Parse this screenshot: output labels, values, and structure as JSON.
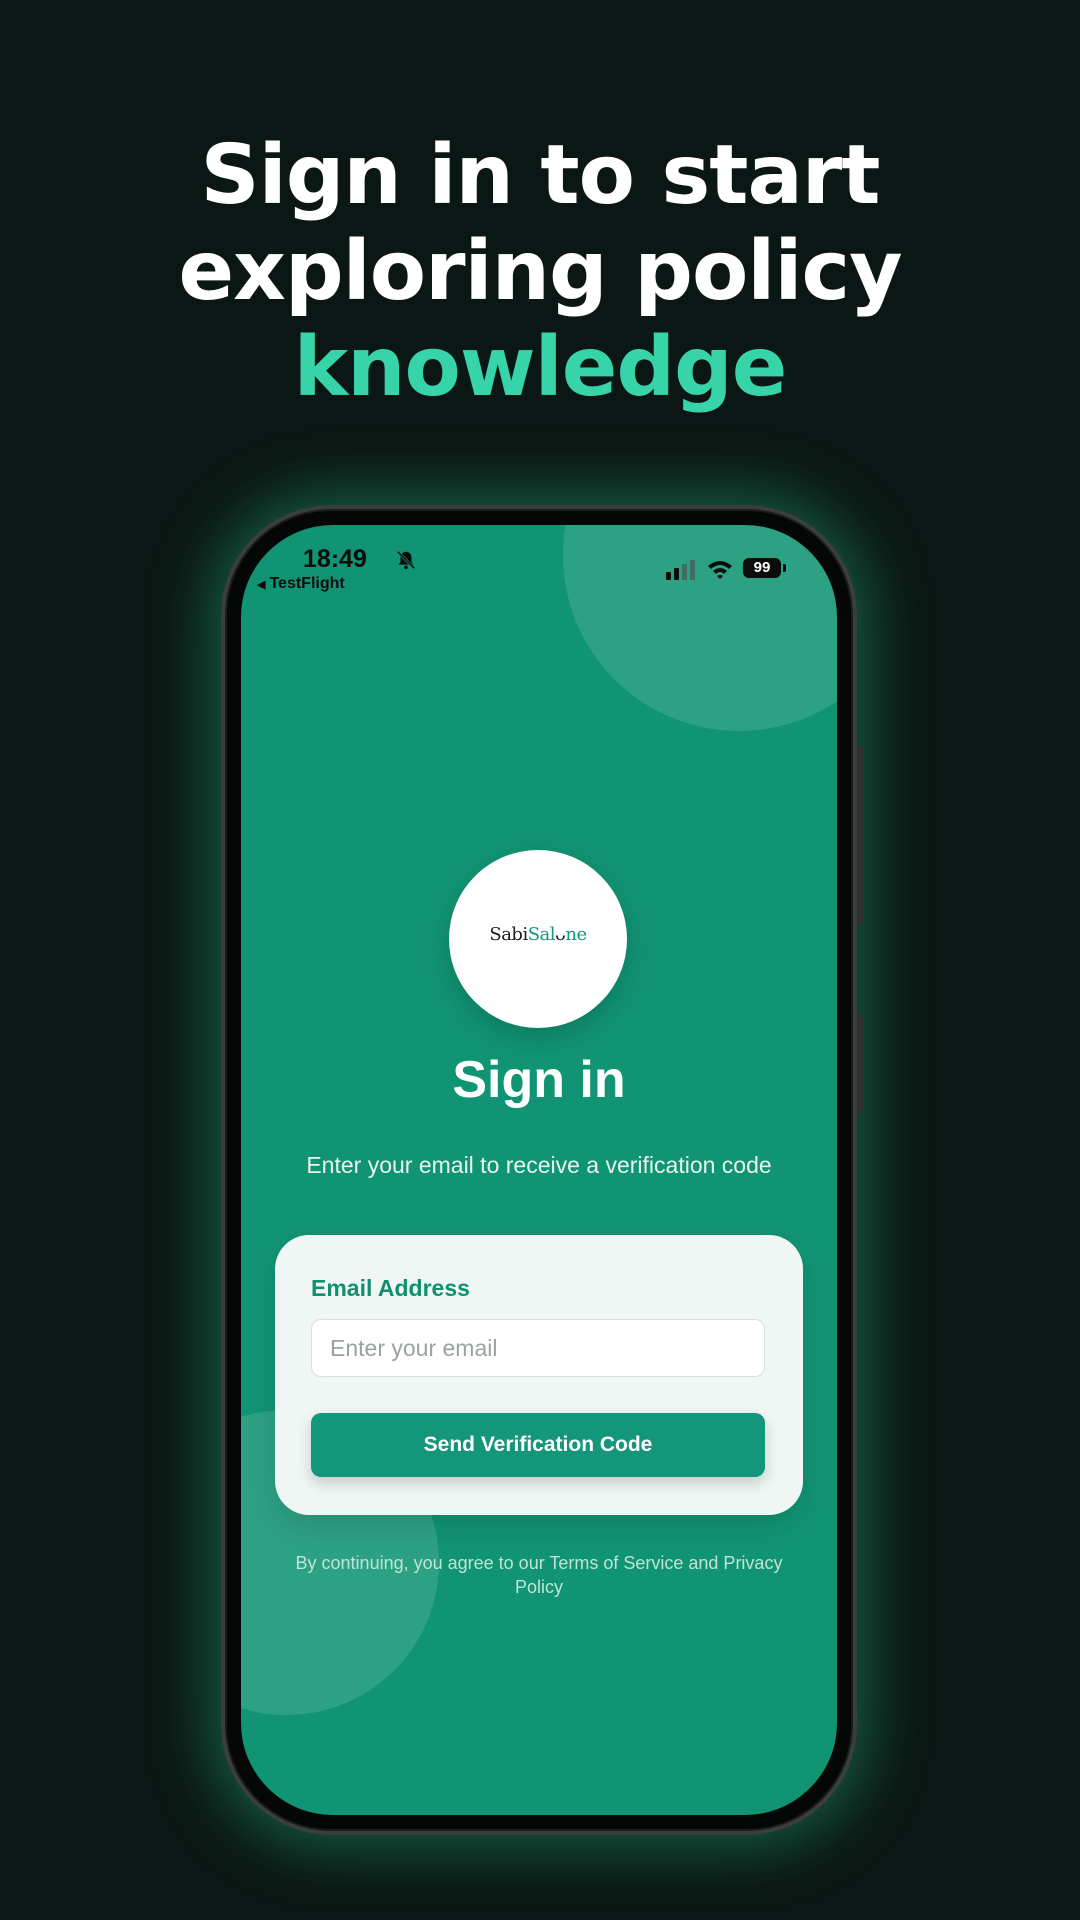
{
  "headline": {
    "line1": "Sign in to start",
    "line2": "exploring policy",
    "accent": "knowledge"
  },
  "status_bar": {
    "time": "18:49",
    "back_app": "TestFlight",
    "battery": "99",
    "icons": [
      "bell-slash-icon",
      "signal-icon",
      "wifi-icon",
      "battery-icon"
    ]
  },
  "logo": {
    "part1": "Sabi",
    "part2": "Sal",
    "part3": "ne"
  },
  "signin": {
    "title": "Sign in",
    "subtitle": "Enter your email to receive a verification code",
    "email_label": "Email Address",
    "email_placeholder": "Enter your email",
    "email_value": "",
    "submit_label": "Send Verification Code",
    "legal": "By continuing, you agree to our Terms of Service and Privacy Policy"
  },
  "colors": {
    "background": "#0b1714",
    "accent": "#37d4a9",
    "screen": "#119474",
    "button": "#13967a",
    "card": "#eff6f4"
  }
}
